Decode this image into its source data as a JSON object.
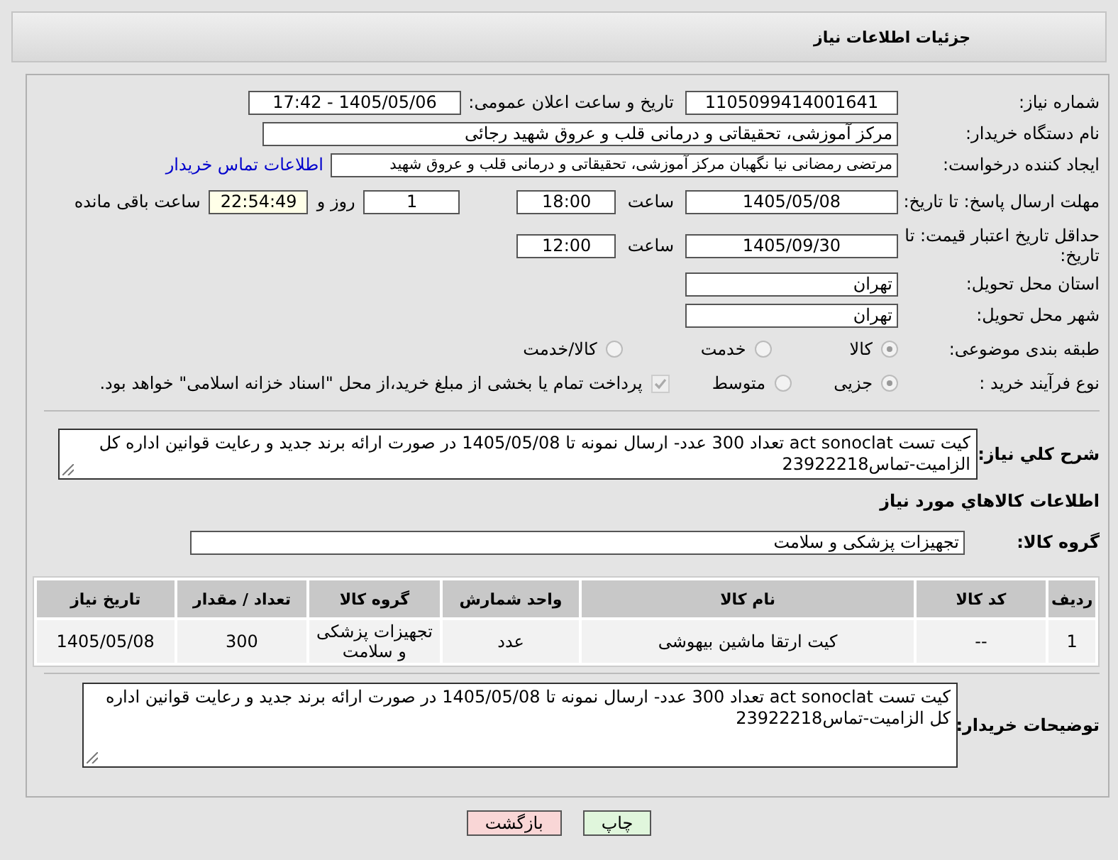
{
  "header": {
    "title": "جزئیات اطلاعات نیاز"
  },
  "need_number": {
    "label": "شماره نیاز:",
    "value": "1105099414001641"
  },
  "announce": {
    "label": "تاریخ و ساعت اعلان عمومی:",
    "value": "1405/05/06 - 17:42"
  },
  "buyer_org": {
    "label": "نام دستگاه خریدار:",
    "value": "مرکز آموزشی، تحقیقاتی و درمانی قلب و عروق شهید رجائی"
  },
  "requester": {
    "label": "ایجاد کننده درخواست:",
    "value": "مرتضی رمضانی نیا نگهبان مرکز آموزشی، تحقیقاتی و درمانی قلب و عروق شهید",
    "link": "اطلاعات تماس خریدار"
  },
  "deadline": {
    "label": "مهلت ارسال پاسخ: تا تاریخ:",
    "date": "1405/05/08",
    "time_label": "ساعت",
    "time": "18:00",
    "days": "1",
    "days_label": "روز و",
    "remaining": "22:54:49",
    "remaining_label": "ساعت باقی مانده"
  },
  "validity": {
    "label": "حداقل تاریخ اعتبار قیمت: تا تاریخ:",
    "date": "1405/09/30",
    "time_label": "ساعت",
    "time": "12:00"
  },
  "province": {
    "label": "استان محل تحویل:",
    "value": "تهران"
  },
  "city": {
    "label": "شهر محل تحویل:",
    "value": "تهران"
  },
  "category": {
    "label": "طبقه بندی موضوعی:",
    "options": [
      {
        "label": "کالا",
        "selected": true
      },
      {
        "label": "خدمت",
        "selected": false
      },
      {
        "label": "کالا/خدمت",
        "selected": false
      }
    ]
  },
  "process": {
    "label": "نوع فرآیند خرید :",
    "options": [
      {
        "label": "جزیی",
        "selected": true
      },
      {
        "label": "متوسط",
        "selected": false
      }
    ],
    "treasury": {
      "label": "پرداخت تمام یا بخشی از مبلغ خرید،از محل \"اسناد خزانه اسلامی\" خواهد بود.",
      "checked": true
    }
  },
  "description": {
    "label": "شرح کلي نياز:",
    "value": "کیت تست act sonoclat  تعداد 300 عدد- ارسال نمونه تا 1405/05/08 در صورت ارائه برند جدید و رعایت قوانین اداره کل الزامیت-تماس23922218"
  },
  "goods_title": "اطلاعات کالاهاي مورد نياز",
  "goods_group": {
    "label": "گروه کالا:",
    "value": "تجهیزات پزشکی و سلامت"
  },
  "table": {
    "columns": [
      "ردیف",
      "کد کالا",
      "نام کالا",
      "واحد شمارش",
      "گروه کالا",
      "تعداد / مقدار",
      "تاریخ نیاز"
    ],
    "rows": [
      [
        "1",
        "--",
        "کیت ارتقا ماشین بیهوشی",
        "عدد",
        "تجهیزات پزشکی و سلامت",
        "300",
        "1405/05/08"
      ]
    ]
  },
  "buyer_notes": {
    "label": "توضیحات خریدار:",
    "value": "کیت تست act sonoclat  تعداد 300 عدد- ارسال نمونه تا 1405/05/08 در صورت ارائه برند جدید و رعایت قوانین اداره کل الزامیت-تماس23922218"
  },
  "buttons": [
    {
      "label": "چاپ",
      "kind": "print"
    },
    {
      "label": "بازگشت",
      "kind": "back"
    }
  ]
}
